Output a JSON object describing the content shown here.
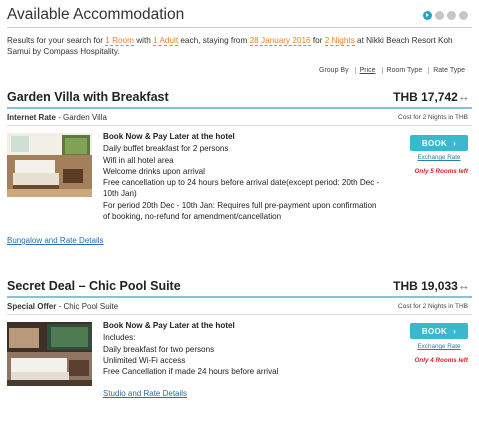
{
  "header": {
    "title": "Available Accommodation",
    "steps": 4
  },
  "search": {
    "prefix": "Results for your search for ",
    "rooms": "1 Room",
    "with": " with ",
    "adults": "1 Adult",
    "staying": " each, staying from ",
    "date": "28 January 2016",
    "for": " for ",
    "nights": "2 Nights",
    "suffix": " at Nikki Beach Resort Koh Samui by Compass Hospitality."
  },
  "sort": {
    "label": "Group By",
    "options": [
      "Price",
      "Room Type",
      "Rate Type"
    ],
    "active": "Price"
  },
  "rooms": [
    {
      "title": "Garden Villa with Breakfast",
      "price": "THB 17,742",
      "price_suffix": "++",
      "rate_name": "Internet Rate",
      "rate_room": " - Garden Villa",
      "cost_note": "Cost for 2 Nights in THB",
      "details": [
        "Book Now & Pay Later at the hotel",
        "Daily buffet breakfast for 2 persons",
        "Wifi in all hotel area",
        "Welcome drinks upon arrival",
        "Free cancellation up to 24 hours before arrival date(except period: 20th Dec - 10th Jan)",
        "For period 20th Dec - 10th Jan: Requires full pre-payment upon confirmation of booking, no-refund for amendment/cancellation"
      ],
      "book_label": "BOOK",
      "exchange_rate": "Exchange Rate",
      "rooms_left": "Only 5 Rooms left",
      "details_link": "Bungalow and Rate Details"
    },
    {
      "title": "Secret Deal – Chic Pool Suite",
      "price": "THB 19,033",
      "price_suffix": "++",
      "rate_name": "Special Offer",
      "rate_room": " - Chic Pool Suite",
      "cost_note": "Cost for 2 Nights in THB",
      "details": [
        "Book Now & Pay Later at the hotel",
        "Includes:",
        "Daily breakfast for two persons",
        "Unlimited Wi-Fi access",
        "Free Cancellation if made 24 hours before arrival"
      ],
      "book_label": "BOOK",
      "exchange_rate": "Exchange Rate",
      "rooms_left": "Only 4 Rooms left",
      "details_link": "Studio and Rate Details"
    }
  ],
  "colors": {
    "accent": "#3ab8cf",
    "highlight": "#e8832a",
    "rooms_left": "#d0262a",
    "link": "#2a6db0"
  }
}
